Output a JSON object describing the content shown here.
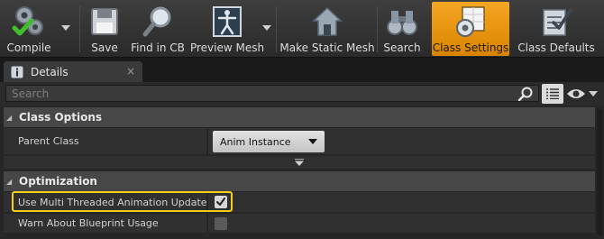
{
  "toolbar": {
    "buttons": [
      {
        "label": "Compile",
        "icon": "compile-icon"
      },
      {
        "label": "Save",
        "icon": "save-icon"
      },
      {
        "label": "Find in CB",
        "icon": "find-in-content-browser-icon"
      },
      {
        "label": "Preview Mesh",
        "icon": "preview-mesh-icon"
      },
      {
        "label": "Make Static Mesh",
        "icon": "make-static-mesh-icon"
      },
      {
        "label": "Search",
        "icon": "binoculars-icon"
      },
      {
        "label": "Class Settings",
        "icon": "class-settings-icon",
        "active": true
      },
      {
        "label": "Class Defaults",
        "icon": "class-defaults-icon"
      }
    ],
    "accent_color": "#e8950f"
  },
  "tab": {
    "label": "Details",
    "close": "×"
  },
  "search": {
    "placeholder": "Search"
  },
  "categories": [
    {
      "label": "Class Options",
      "properties": [
        {
          "label": "Parent Class",
          "value": "Anim Instance"
        }
      ]
    },
    {
      "label": "Optimization",
      "properties": [
        {
          "label": "Use Multi Threaded Animation Update",
          "checked": true,
          "highlighted": true
        },
        {
          "label": "Warn About Blueprint Usage",
          "checked": false
        }
      ]
    }
  ],
  "colors": {
    "highlight": "#f2d01a"
  }
}
